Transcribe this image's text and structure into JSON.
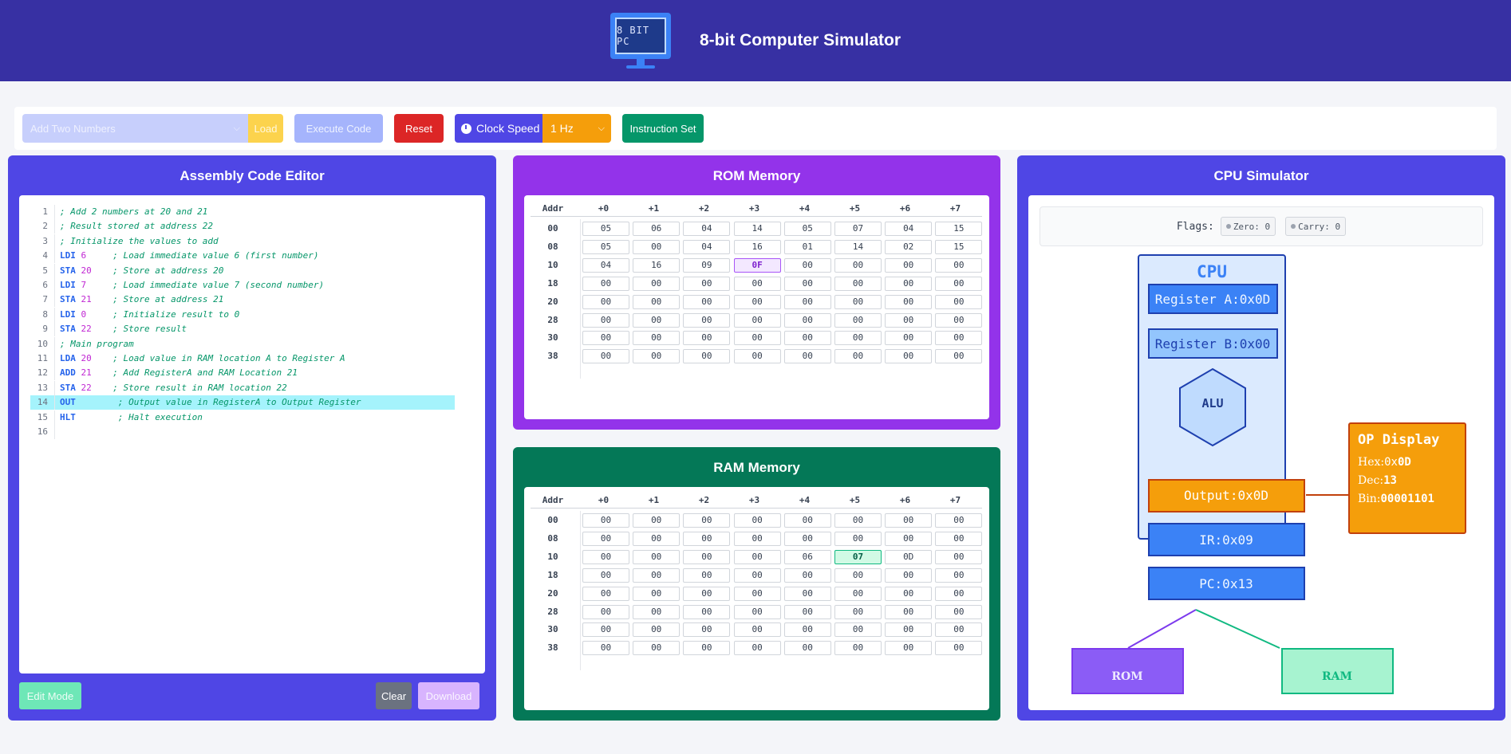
{
  "header": {
    "title": "8-bit Computer Simulator",
    "logo_text": "8 BIT PC"
  },
  "toolbar": {
    "program_select": "Add Two Numbers",
    "load_label": "Load",
    "execute_label": "Execute Code",
    "reset_label": "Reset",
    "clock_label": "Clock Speed",
    "clock_value": "1 Hz",
    "instruction_set_label": "Instruction Set"
  },
  "editor": {
    "title": "Assembly Code Editor",
    "highlight_line": 14,
    "lines": [
      {
        "n": "1",
        "kw": "",
        "num": "",
        "pad": "",
        "comment": "; Add 2 numbers at 20 and 21"
      },
      {
        "n": "2",
        "kw": "",
        "num": "",
        "pad": "",
        "comment": "; Result stored at address 22"
      },
      {
        "n": "3",
        "kw": "",
        "num": "",
        "pad": "",
        "comment": "; Initialize the values to add"
      },
      {
        "n": "4",
        "kw": "LDI",
        "num": "6",
        "pad": "     ",
        "comment": "; Load immediate value 6 (first number)"
      },
      {
        "n": "5",
        "kw": "STA",
        "num": "20",
        "pad": "    ",
        "comment": "; Store at address 20"
      },
      {
        "n": "6",
        "kw": "LDI",
        "num": "7",
        "pad": "     ",
        "comment": "; Load immediate value 7 (second number)"
      },
      {
        "n": "7",
        "kw": "STA",
        "num": "21",
        "pad": "    ",
        "comment": "; Store at address 21"
      },
      {
        "n": "8",
        "kw": "LDI",
        "num": "0",
        "pad": "     ",
        "comment": "; Initialize result to 0"
      },
      {
        "n": "9",
        "kw": "STA",
        "num": "22",
        "pad": "    ",
        "comment": "; Store result"
      },
      {
        "n": "10",
        "kw": "",
        "num": "",
        "pad": "",
        "comment": "; Main program"
      },
      {
        "n": "11",
        "kw": "LDA",
        "num": "20",
        "pad": "    ",
        "comment": "; Load value in RAM location A to Register A"
      },
      {
        "n": "12",
        "kw": "ADD",
        "num": "21",
        "pad": "    ",
        "comment": "; Add RegisterA and RAM Location 21"
      },
      {
        "n": "13",
        "kw": "STA",
        "num": "22",
        "pad": "    ",
        "comment": "; Store result in RAM location 22"
      },
      {
        "n": "14",
        "kw": "OUT",
        "num": "",
        "pad": "       ",
        "comment": "; Output value in RegisterA to Output Register"
      },
      {
        "n": "15",
        "kw": "HLT",
        "num": "",
        "pad": "       ",
        "comment": "; Halt execution"
      },
      {
        "n": "16",
        "kw": "",
        "num": "",
        "pad": "",
        "comment": ""
      }
    ],
    "edit_mode_label": "Edit Mode",
    "clear_label": "Clear",
    "download_label": "Download"
  },
  "rom": {
    "title": "ROM Memory",
    "highlight": {
      "row": 2,
      "col": 3
    },
    "rows": [
      {
        "addr": "00",
        "cells": [
          "05",
          "06",
          "04",
          "14",
          "05",
          "07",
          "04",
          "15"
        ]
      },
      {
        "addr": "08",
        "cells": [
          "05",
          "00",
          "04",
          "16",
          "01",
          "14",
          "02",
          "15"
        ]
      },
      {
        "addr": "10",
        "cells": [
          "04",
          "16",
          "09",
          "0F",
          "00",
          "00",
          "00",
          "00"
        ]
      },
      {
        "addr": "18",
        "cells": [
          "00",
          "00",
          "00",
          "00",
          "00",
          "00",
          "00",
          "00"
        ]
      },
      {
        "addr": "20",
        "cells": [
          "00",
          "00",
          "00",
          "00",
          "00",
          "00",
          "00",
          "00"
        ]
      },
      {
        "addr": "28",
        "cells": [
          "00",
          "00",
          "00",
          "00",
          "00",
          "00",
          "00",
          "00"
        ]
      },
      {
        "addr": "30",
        "cells": [
          "00",
          "00",
          "00",
          "00",
          "00",
          "00",
          "00",
          "00"
        ]
      },
      {
        "addr": "38",
        "cells": [
          "00",
          "00",
          "00",
          "00",
          "00",
          "00",
          "00",
          "00"
        ]
      }
    ]
  },
  "ram": {
    "title": "RAM Memory",
    "highlight": {
      "row": 2,
      "col": 5
    },
    "rows": [
      {
        "addr": "00",
        "cells": [
          "00",
          "00",
          "00",
          "00",
          "00",
          "00",
          "00",
          "00"
        ]
      },
      {
        "addr": "08",
        "cells": [
          "00",
          "00",
          "00",
          "00",
          "00",
          "00",
          "00",
          "00"
        ]
      },
      {
        "addr": "10",
        "cells": [
          "00",
          "00",
          "00",
          "00",
          "06",
          "07",
          "0D",
          "00"
        ]
      },
      {
        "addr": "18",
        "cells": [
          "00",
          "00",
          "00",
          "00",
          "00",
          "00",
          "00",
          "00"
        ]
      },
      {
        "addr": "20",
        "cells": [
          "00",
          "00",
          "00",
          "00",
          "00",
          "00",
          "00",
          "00"
        ]
      },
      {
        "addr": "28",
        "cells": [
          "00",
          "00",
          "00",
          "00",
          "00",
          "00",
          "00",
          "00"
        ]
      },
      {
        "addr": "30",
        "cells": [
          "00",
          "00",
          "00",
          "00",
          "00",
          "00",
          "00",
          "00"
        ]
      },
      {
        "addr": "38",
        "cells": [
          "00",
          "00",
          "00",
          "00",
          "00",
          "00",
          "00",
          "00"
        ]
      }
    ]
  },
  "memory_headers": [
    "Addr",
    "+0",
    "+1",
    "+2",
    "+3",
    "+4",
    "+5",
    "+6",
    "+7"
  ],
  "cpu": {
    "title": "CPU Simulator",
    "flags_label": "Flags:",
    "zero_flag": "Zero: 0",
    "carry_flag": "Carry: 0",
    "cpu_label": "CPU",
    "register_a": "Register A:0x0D",
    "register_b": "Register B:0x00",
    "alu_label": "ALU",
    "output": "Output:0x0D",
    "ir": "IR:0x09",
    "pc": "PC:0x13",
    "rom_label": "ROM",
    "ram_label": "RAM",
    "op_display": {
      "title": "OP Display",
      "hex_label": "Hex:",
      "hex_prefix": "0x",
      "hex_value": "0D",
      "dec_label": "Dec:",
      "dec_value": "13",
      "bin_label": "Bin:",
      "bin_value": "00001101"
    }
  }
}
